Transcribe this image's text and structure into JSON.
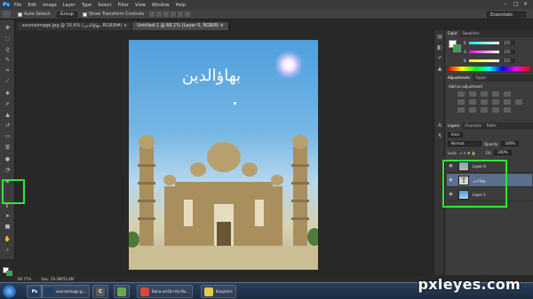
{
  "app": {
    "logo": "Ps"
  },
  "menubar": {
    "items": [
      "File",
      "Edit",
      "Image",
      "Layer",
      "Type",
      "Select",
      "Filter",
      "View",
      "Window",
      "Help"
    ]
  },
  "options": {
    "auto_select_label": "Auto-Select:",
    "auto_select_value": "Group",
    "show_transform_label": "Show Transform Controls",
    "workspace_value": "Essentials"
  },
  "tabs": [
    {
      "label": "sourceimage.jpg @ 16.6% (بهاؤالدين, RGB/8#) ×",
      "active": false
    },
    {
      "label": "Untitled-1 @ 66.1% (Layer 0, RGB/8) ×",
      "active": true
    }
  ],
  "document": {
    "title_text": "بهاؤالدين"
  },
  "status": {
    "zoom": "66.77%",
    "doc_size": "Doc: 39.3M/55.4M"
  },
  "color_panel": {
    "tabs": [
      "Color",
      "Swatches"
    ],
    "sliders": [
      {
        "label": "R",
        "value": "255",
        "gradient": "linear-gradient(to right,#00ffff,#ffffff)"
      },
      {
        "label": "G",
        "value": "255",
        "gradient": "linear-gradient(to right,#ff00ff,#ffffff)"
      },
      {
        "label": "B",
        "value": "255",
        "gradient": "linear-gradient(to right,#ffff00,#ffffff)"
      }
    ]
  },
  "adjustments": {
    "tabs": [
      "Adjustments",
      "Styles"
    ],
    "heading": "Add an adjustment"
  },
  "layers_panel": {
    "tabs": [
      "Layers",
      "Channels",
      "Paths"
    ],
    "kind_label": "Kind",
    "blend_mode": "Normal",
    "opacity_label": "Opacity:",
    "opacity_value": "100%",
    "lock_label": "Lock:",
    "fill_label": "Fill:",
    "fill_value": "100%",
    "layers": [
      {
        "name": "Layer 0",
        "thumb": "image",
        "selected": false
      },
      {
        "name": "بهاؤالدين",
        "thumb": "text",
        "thumb_glyph": "T",
        "selected": true
      },
      {
        "name": "Layer 1",
        "thumb": "sky",
        "selected": false
      }
    ]
  },
  "taskbar": {
    "items": [
      {
        "label": "",
        "color": "#1a3f6b",
        "glyph": "Ps"
      },
      {
        "label": "sourceimage.jp...",
        "color": "#1a3f6b",
        "glyph": ""
      },
      {
        "label": "",
        "color": "#5a5a5a",
        "glyph": "C"
      },
      {
        "label": "",
        "color": "#6aa84f",
        "glyph": ""
      },
      {
        "label": "Baha-ud-Din Ka Ma...",
        "color": "#d44a3a",
        "glyph": ""
      },
      {
        "label": "Kaaphers",
        "color": "#e8c84a",
        "glyph": ""
      }
    ]
  },
  "watermark": "pxleyes.com",
  "highlight_color": "#2ee73a"
}
